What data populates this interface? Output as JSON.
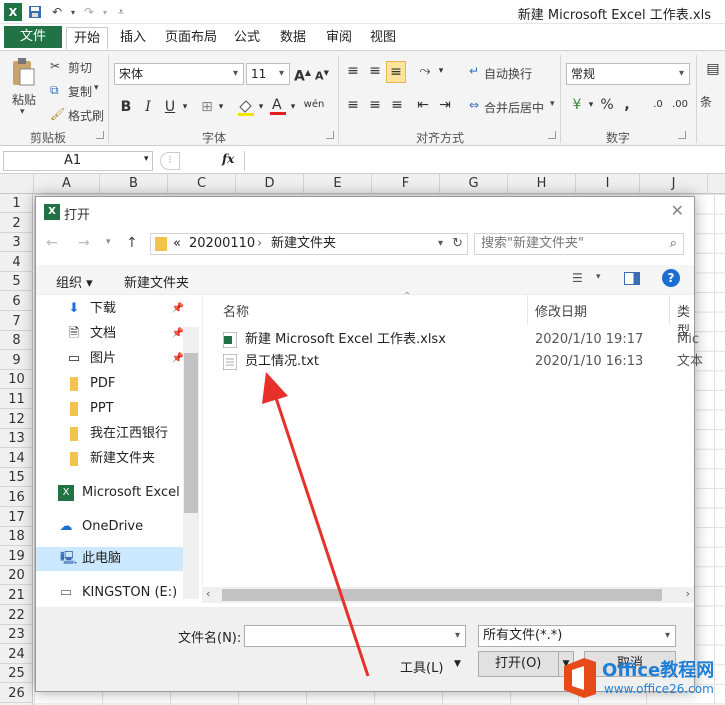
{
  "window": {
    "title": "新建 Microsoft Excel 工作表.xls"
  },
  "ribbon_tabs": [
    "文件",
    "开始",
    "插入",
    "页面布局",
    "公式",
    "数据",
    "审阅",
    "视图"
  ],
  "ribbon": {
    "clipboard": {
      "paste": "粘贴",
      "cut": "剪切",
      "copy": "复制",
      "format_painter": "格式刷",
      "group": "剪贴板"
    },
    "font": {
      "name": "宋体",
      "size": "11",
      "group": "字体"
    },
    "alignment": {
      "wrap": "自动换行",
      "merge": "合并后居中",
      "group": "对齐方式"
    },
    "number": {
      "format": "常规",
      "group": "数字",
      "more": "条"
    }
  },
  "formula_bar": {
    "name_box": "A1",
    "fx": "fx"
  },
  "columns": [
    "A",
    "B",
    "C",
    "D",
    "E",
    "F",
    "G",
    "H",
    "I",
    "J"
  ],
  "rows": [
    "1",
    "2",
    "3",
    "4",
    "5",
    "6",
    "7",
    "8",
    "9",
    "10",
    "11",
    "12",
    "13",
    "14",
    "15",
    "16",
    "17",
    "18",
    "19",
    "20",
    "21",
    "22",
    "23",
    "24",
    "25",
    "26"
  ],
  "dialog": {
    "title": "打开",
    "breadcrumb": {
      "root": "«",
      "parent": "20200110",
      "current": "新建文件夹"
    },
    "search_placeholder": "搜索\"新建文件夹\"",
    "organize": "组织 ▾",
    "new_folder": "新建文件夹",
    "nav": [
      {
        "label": "下载",
        "icon": "download-icon",
        "pinned": true
      },
      {
        "label": "文档",
        "icon": "document-icon",
        "pinned": true
      },
      {
        "label": "图片",
        "icon": "picture-icon",
        "pinned": true
      },
      {
        "label": "PDF",
        "icon": "folder-icon",
        "pinned": false
      },
      {
        "label": "PPT",
        "icon": "folder-icon",
        "pinned": false
      },
      {
        "label": "我在江西银行",
        "icon": "folder-icon",
        "pinned": false
      },
      {
        "label": "新建文件夹",
        "icon": "folder-icon",
        "pinned": false
      },
      {
        "label": "Microsoft Excel",
        "icon": "excel-icon",
        "pinned": false
      },
      {
        "label": "OneDrive",
        "icon": "cloud-icon",
        "pinned": false
      },
      {
        "label": "此电脑",
        "icon": "computer-icon",
        "pinned": false
      },
      {
        "label": "KINGSTON (E:)",
        "icon": "drive-icon",
        "pinned": false
      }
    ],
    "columns": {
      "name": "名称",
      "date": "修改日期",
      "type": "类型"
    },
    "files": [
      {
        "name": "新建 Microsoft Excel 工作表.xlsx",
        "date": "2020/1/10 19:17",
        "type": "Mic",
        "icon": "excel-file-icon"
      },
      {
        "name": "员工情况.txt",
        "date": "2020/1/10 16:13",
        "type": "文本",
        "icon": "text-file-icon"
      }
    ],
    "filename_label": "文件名(N):",
    "filename_value": "",
    "filetype": "所有文件(*.*)",
    "tools": "工具(L)",
    "open": "打开(O)",
    "cancel": "取消"
  },
  "watermark": {
    "brand": "Office教程网",
    "url": "www.office26.com"
  },
  "colors": {
    "excel_green": "#217346",
    "arrow_red": "#e8302a",
    "selected_nav": "#cce8ff"
  }
}
